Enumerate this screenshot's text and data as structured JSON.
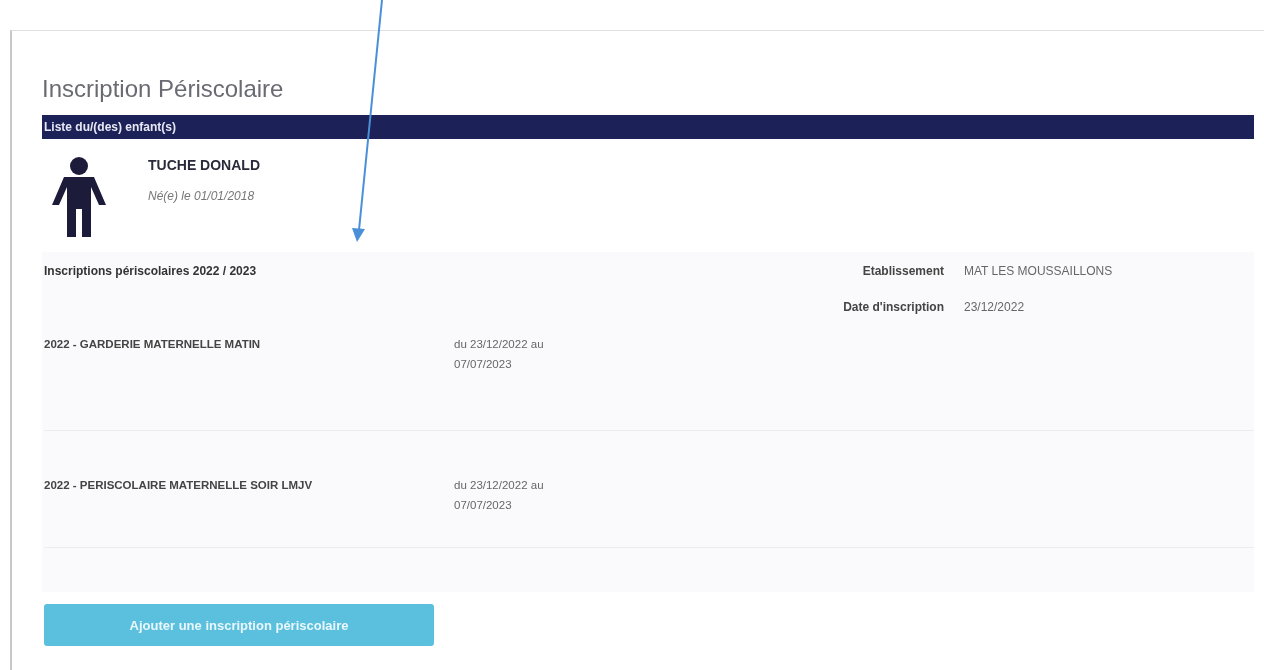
{
  "page_title": "Inscription Périscolaire",
  "section_bar": "Liste du/(des) enfant(s)",
  "child": {
    "name": "TUCHE DONALD",
    "birth": "Né(e) le 01/01/2018"
  },
  "registrations": {
    "heading": "Inscriptions périscolaires 2022 / 2023",
    "details": [
      {
        "label": "Etablissement",
        "value": "MAT LES MOUSSAILLONS"
      },
      {
        "label": "Date d'inscription",
        "value": "23/12/2022"
      }
    ],
    "rows": [
      {
        "activity": "2022 - GARDERIE MATERNELLE MATIN",
        "period": "du 23/12/2022 au 07/07/2023"
      },
      {
        "activity": "2022 - PERISCOLAIRE MATERNELLE SOIR LMJV",
        "period": "du 23/12/2022 au 07/07/2023"
      }
    ]
  },
  "add_button": "Ajouter une inscription périscolaire"
}
